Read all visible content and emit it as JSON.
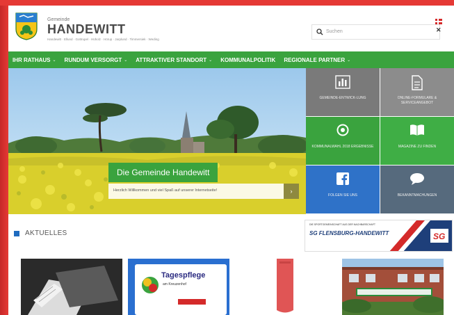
{
  "header": {
    "logo_small": "Gemeinde",
    "logo_big": "HANDEWITT",
    "logo_places": "Handewitt · Ellund · Gottrupel · Hüholz · Hörup · Jarplund · Timmersiek · Weding",
    "search_placeholder": "Suchen"
  },
  "nav": {
    "items": [
      {
        "label": "IHR RATHAUS",
        "dropdown": true
      },
      {
        "label": "RUNDUM VERSORGT",
        "dropdown": true
      },
      {
        "label": "ATTRAKTIVER STANDORT",
        "dropdown": true
      },
      {
        "label": "KOMMUNALPOLITIK",
        "dropdown": false
      },
      {
        "label": "REGIONALE PARTNER",
        "dropdown": true
      }
    ]
  },
  "hero": {
    "title": "Die Gemeinde Handewitt",
    "subtitle": "Herzlich Willkommen und viel Spaß auf unserer Internetseite!",
    "next": "›"
  },
  "tiles": [
    {
      "label": "GEMEINDE-ENTWICK-LUNG",
      "icon": "bar-chart-icon",
      "color": "#7a7a7a"
    },
    {
      "label": "ONLINE-FORMULARE & SERVICEANGEBOT",
      "icon": "document-icon",
      "color": "#8c8c8c"
    },
    {
      "label": "KOMMUNALWAHL 2018 ERGEBNISSE",
      "icon": "target-icon",
      "color": "#3aa33e"
    },
    {
      "label": "MAGAZINE ZU FINDEN",
      "icon": "book-icon",
      "color": "#3fae45"
    },
    {
      "label": "FOLGEN SIE UNS",
      "icon": "facebook-icon",
      "color": "#2f72c8"
    },
    {
      "label": "BEKANNTMACHUNGEN",
      "icon": "speech-bubble-icon",
      "color": "#566a7d"
    }
  ],
  "aktuelles": {
    "heading": "AKTUELLES"
  },
  "banner": {
    "line1": "DIE SPORTGEMEINSCHAFT AUS DER NACHBARSCHAFT",
    "line2": "SG FLENSBURG-HANDEWITT",
    "line3": "",
    "badge": "SG"
  },
  "thumbs": {
    "tagespflege_title": "Tagespflege",
    "tagespflege_sub": "am Kreuzenhof"
  },
  "colors": {
    "green": "#3aa33e",
    "blue": "#1e6bbf",
    "frame_red": "#e53935"
  }
}
